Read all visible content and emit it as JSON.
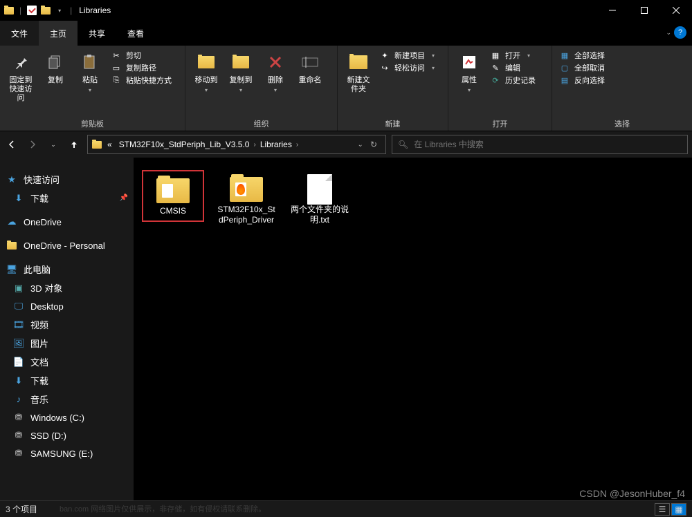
{
  "window": {
    "title": "Libraries"
  },
  "menu": {
    "file": "文件",
    "home": "主页",
    "share": "共享",
    "view": "查看"
  },
  "ribbon": {
    "clipboard": {
      "label": "剪贴板",
      "pin": "固定到快速访问",
      "copy": "复制",
      "paste": "粘贴",
      "cut": "剪切",
      "copy_path": "复制路径",
      "paste_shortcut": "粘贴快捷方式"
    },
    "organize": {
      "label": "组织",
      "move_to": "移动到",
      "copy_to": "复制到",
      "delete": "删除",
      "rename": "重命名"
    },
    "new": {
      "label": "新建",
      "new_folder": "新建文件夹",
      "new_item": "新建项目",
      "easy_access": "轻松访问"
    },
    "open": {
      "label": "打开",
      "properties": "属性",
      "open": "打开",
      "edit": "编辑",
      "history": "历史记录"
    },
    "select": {
      "label": "选择",
      "select_all": "全部选择",
      "select_none": "全部取消",
      "invert": "反向选择"
    }
  },
  "breadcrumb": {
    "prefix": "«",
    "item1": "STM32F10x_StdPeriph_Lib_V3.5.0",
    "item2": "Libraries"
  },
  "search": {
    "placeholder": "在 Libraries 中搜索"
  },
  "sidebar": {
    "quick_access": "快速访问",
    "downloads": "下载",
    "onedrive": "OneDrive",
    "onedrive_personal": "OneDrive - Personal",
    "this_pc": "此电脑",
    "objects_3d": "3D 对象",
    "desktop": "Desktop",
    "videos": "视频",
    "pictures": "图片",
    "documents": "文档",
    "downloads2": "下载",
    "music": "音乐",
    "drive_c": "Windows (C:)",
    "drive_d": "SSD (D:)",
    "drive_e": "SAMSUNG (E:)"
  },
  "files": {
    "items": [
      {
        "name": "CMSIS",
        "type": "folder",
        "highlighted": true
      },
      {
        "name": "STM32F10x_StdPeriph_Driver",
        "type": "folder_fire"
      },
      {
        "name": "两个文件夹的说明.txt",
        "type": "text"
      }
    ]
  },
  "status": {
    "count": "3 个项目"
  },
  "watermark": "CSDN @JesonHuber_f4",
  "wm2": "ban.com 网络图片仅供展示，非存储，如有侵权请联系删除。"
}
